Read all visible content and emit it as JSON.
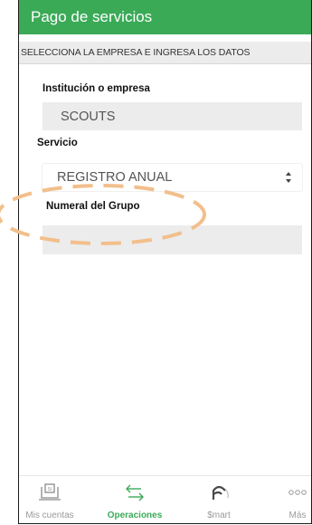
{
  "header": {
    "title": "Pago de servicios"
  },
  "section": {
    "instructions": "SELECCIONA LA EMPRESA E INGRESA LOS DATOS"
  },
  "form": {
    "institution_label": "Institución o empresa",
    "institution_value": "SCOUTS",
    "service_label": "Servicio",
    "service_value": "REGISTRO ANUAL",
    "group_number_label": "Numeral del Grupo",
    "group_number_value": ""
  },
  "tabbar": {
    "tabs": [
      {
        "label": "Mis cuentas",
        "icon": "accounts-icon",
        "active": false
      },
      {
        "label": "Operaciones",
        "icon": "transfer-arrows-icon",
        "active": true
      },
      {
        "label": "$mart",
        "icon": "smart-icon",
        "active": false
      },
      {
        "label": "Más",
        "icon": "more-dots-icon",
        "active": false
      }
    ]
  },
  "colors": {
    "brand_green": "#3aaa57",
    "annotation_orange": "#f2bf8c",
    "field_gray": "#ececec"
  }
}
